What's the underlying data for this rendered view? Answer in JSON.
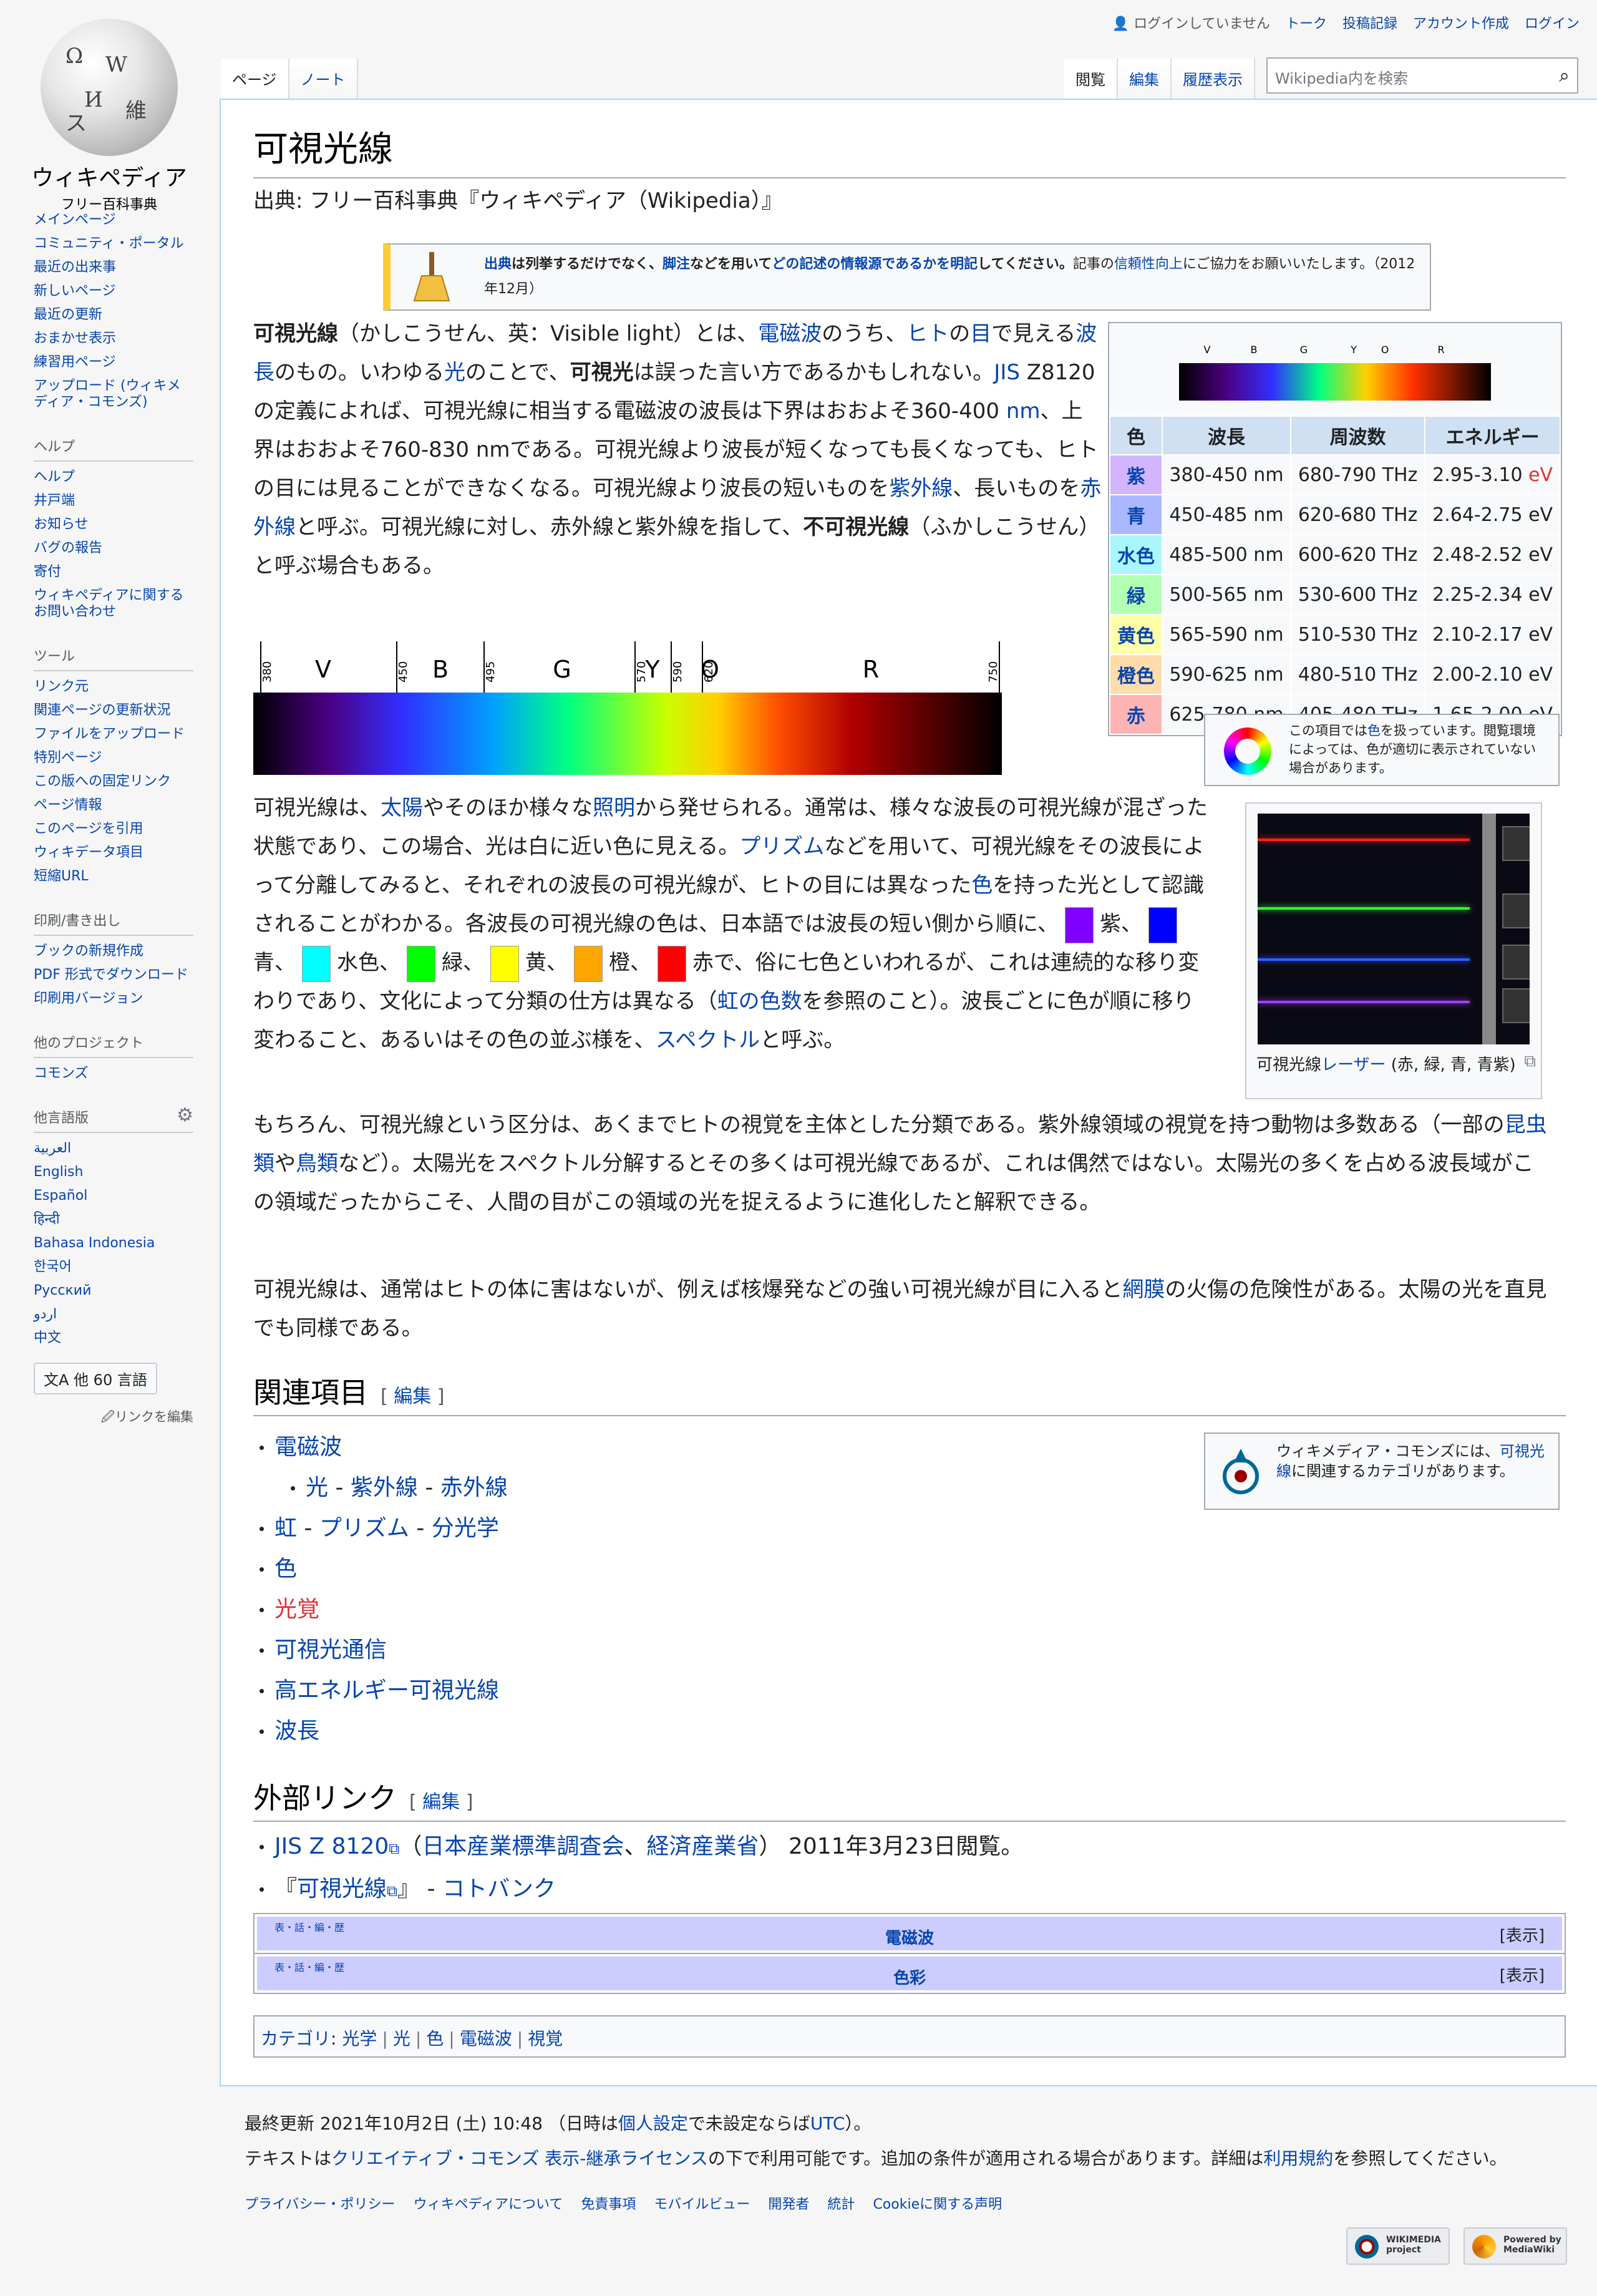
{
  "logo": {
    "wordmark": "ウィキペディア",
    "tagline": "フリー百科事典"
  },
  "personal": {
    "status": "ログインしていません",
    "talk": "トーク",
    "contribs": "投稿記録",
    "create": "アカウント作成",
    "login": "ログイン"
  },
  "tabs": {
    "page": "ページ",
    "note": "ノート",
    "read": "閲覧",
    "edit": "編集",
    "history": "履歴表示"
  },
  "search": {
    "placeholder": "Wikipedia内を検索"
  },
  "sidebar": {
    "nav": [
      "メインページ",
      "コミュニティ・ポータル",
      "最近の出来事",
      "新しいページ",
      "最近の更新",
      "おまかせ表示",
      "練習用ページ",
      "アップロード (ウィキメディア・コモンズ)"
    ],
    "help_heading": "ヘルプ",
    "help": [
      "ヘルプ",
      "井戸端",
      "お知らせ",
      "バグの報告",
      "寄付",
      "ウィキペディアに関するお問い合わせ"
    ],
    "tools_heading": "ツール",
    "tools": [
      "リンク元",
      "関連ページの更新状況",
      "ファイルをアップロード",
      "特別ページ",
      "この版への固定リンク",
      "ページ情報",
      "このページを引用",
      "ウィキデータ項目",
      "短縮URL"
    ],
    "print_heading": "印刷/書き出し",
    "print": [
      "ブックの新規作成",
      "PDF 形式でダウンロード",
      "印刷用バージョン"
    ],
    "projects_heading": "他のプロジェクト",
    "projects": [
      "コモンズ"
    ],
    "lang_heading": "他言語版",
    "langs": [
      "العربية",
      "English",
      "Español",
      "हिन्दी",
      "Bahasa Indonesia",
      "한국어",
      "Русский",
      "اردو",
      "中文"
    ],
    "lang_button": "文A 他 60 言語",
    "edit_links": "🖉リンクを編集"
  },
  "article": {
    "title": "可視光線",
    "site_sub": "出典: フリー百科事典『ウィキペディア（Wikipedia）』",
    "ambox": {
      "a1": "出典",
      "t1": "は列挙するだけでなく、",
      "a2": "脚注",
      "t2": "などを用いて",
      "a3": "どの記述の情報源であるかを明記",
      "t3": "してください。",
      "t4": "記事の",
      "a4": "信頼性向上",
      "t5": "にご協力をお願いいたします。（2012年12月）"
    },
    "p1": {
      "b1": "可視光線",
      "t1": "（かしこうせん、英：Visible light）とは、",
      "l1": "電磁波",
      "t2": "のうち、",
      "l2": "ヒト",
      "t3": "の",
      "l3": "目",
      "t4": "で見える",
      "l4": "波長",
      "t5": "のもの。いわゆる",
      "l5": "光",
      "t6": "のことで、",
      "b2": "可視光",
      "t7": "は誤った言い方であるかもしれない。",
      "l6": "JIS",
      "t8": " Z8120の定義によれば、可視光線に相当する電磁波の波長は下界はおおよそ360-400 ",
      "l7": "nm",
      "t9": "、上界はおおよそ760-830 nmである。可視光線より波長が短くなっても長くなっても、ヒトの目には見ることができなくなる。可視光線より波長の短いものを",
      "l8": "紫外線",
      "t10": "、長いものを",
      "l9": "赤外線",
      "t11": "と呼ぶ。可視光線に対し、赤外線と紫外線を指して、",
      "b3": "不可視光線",
      "t12": "（ふかしこうせん）と呼ぶ場合もある。"
    },
    "p2": {
      "t1": "可視光線は、",
      "l1": "太陽",
      "t2": "やそのほか様々な",
      "l2": "照明",
      "t3": "から発せられる。通常は、様々な波長の可視光線が混ざった状態であり、この場合、光は白に近い色に見える。",
      "l3": "プリズム",
      "t4": "などを用いて、可視光線をその波長によって分離してみると、それぞれの波長の可視光線が、ヒトの目には異なった",
      "l4": "色",
      "t5": "を持った光として認識されることがわかる。各波長の可視光線の色は、日本語では波長の短い側から順に、",
      "c1": "紫、",
      "c2": "青、",
      "c3": "水色、",
      "c4": "緑、",
      "c5": "黄、",
      "c6": "橙、",
      "c7": "赤",
      "t6": "で、俗に七色といわれるが、これは連続的な移り変わりであり、文化によって分類の仕方は異なる（",
      "l5": "虹の色数",
      "t7": "を参照のこと）。波長ごとに色が順に移り変わること、あるいはその色の並ぶ様を、",
      "l6": "スペクトル",
      "t8": "と呼ぶ。"
    },
    "p3": {
      "t1": "もちろん、可視光線という区分は、あくまでヒトの視覚を主体とした分類である。紫外線領域の視覚を持つ動物は多数ある（一部の",
      "l1": "昆虫類",
      "t2": "や",
      "l2": "鳥類",
      "t3": "など）。太陽光をスペクトル分解するとその多くは可視光線であるが、これは偶然ではない。太陽光の多くを占める波長域がこの領域だったからこそ、人間の目がこの領域の光を捉えるように進化したと解釈できる。"
    },
    "p4": {
      "t1": "可視光線は、通常はヒトの体に害はないが、例えば核爆発などの強い可視光線が目に入ると",
      "l1": "網膜",
      "t2": "の火傷の危険性がある。太陽の光を直見でも同様である。"
    },
    "spectrum": {
      "bands": [
        {
          "label": "V",
          "wl": "380"
        },
        {
          "label": "B",
          "wl": "450"
        },
        {
          "label": "G",
          "wl": "495"
        },
        {
          "label": "Y",
          "wl": "570"
        },
        {
          "label": "O",
          "wl": "590"
        },
        {
          "label": "R",
          "wl": "620"
        }
      ],
      "end": "750"
    },
    "infobox": {
      "spec_letters": [
        "V",
        "B",
        "G",
        "Y",
        "O",
        "R"
      ],
      "headers": [
        "色",
        "波長",
        "周波数",
        "エネルギー"
      ],
      "rows": [
        {
          "name": "紫",
          "bg": "#d2b4ff",
          "wl": "380-450 nm",
          "freq": "680-790 THz",
          "energy": "2.95-3.10 ",
          "unit": "eV"
        },
        {
          "name": "青",
          "bg": "#aab7ff",
          "wl": "450-485 nm",
          "freq": "620-680 THz",
          "energy": "2.64-2.75 eV",
          "unit": ""
        },
        {
          "name": "水色",
          "bg": "#aaf6ff",
          "wl": "485-500 nm",
          "freq": "600-620 THz",
          "energy": "2.48-2.52 eV",
          "unit": ""
        },
        {
          "name": "緑",
          "bg": "#b3ffb3",
          "wl": "500-565 nm",
          "freq": "530-600 THz",
          "energy": "2.25-2.34 eV",
          "unit": ""
        },
        {
          "name": "黄色",
          "bg": "#ffffaa",
          "wl": "565-590 nm",
          "freq": "510-530 THz",
          "energy": "2.10-2.17 eV",
          "unit": ""
        },
        {
          "name": "橙色",
          "bg": "#ffdcaa",
          "wl": "590-625 nm",
          "freq": "480-510 THz",
          "energy": "2.00-2.10 eV",
          "unit": ""
        },
        {
          "name": "赤",
          "bg": "#ffb4b4",
          "wl": "625-780 nm",
          "freq": "405-480 THz",
          "energy": "1.65-2.00 eV",
          "unit": ""
        }
      ]
    },
    "color_note": {
      "t1": "この項目では",
      "l1": "色",
      "t2": "を扱っています。閲覧環境によっては、色が適切に表示されていない場合があります。"
    },
    "thumb": {
      "t1": "可視光線",
      "l1": "レーザー",
      "t2": " (赤, 緑, 青, 青紫)"
    },
    "related": {
      "heading": "関連項目",
      "edit": "編集",
      "items": [
        "電磁波",
        "光",
        "紫外線",
        "赤外線",
        "虹",
        "プリズム",
        "分光学",
        "色",
        "光覚",
        "可視光通信",
        "高エネルギー可視光線",
        "波長"
      ]
    },
    "commons": {
      "t1": "ウィキメディア・コモンズには、",
      "l1": "可視光線",
      "t2": "に関連するカテゴリがあります。"
    },
    "external": {
      "heading": "外部リンク",
      "edit": "編集",
      "e1_link": "JIS Z 8120",
      "e1_a": "（",
      "e1_l2": "日本産業標準調査会",
      "e1_b": "、",
      "e1_l3": "経済産業省",
      "e1_c": "） 2011年3月23日閲覧。",
      "e2_a": "『",
      "e2_link": "可視光線",
      "e2_b": "』 - ",
      "e2_l2": "コトバンク"
    },
    "navboxes": [
      {
        "vte": "表・話・編・歴",
        "title": "電磁波",
        "show": "[表示]"
      },
      {
        "vte": "表・話・編・歴",
        "title": "色彩",
        "show": "[表示]"
      }
    ],
    "categories": {
      "label": "カテゴリ",
      "items": [
        "光学",
        "光",
        "色",
        "電磁波",
        "視覚"
      ]
    }
  },
  "footer": {
    "lastmod_a": "最終更新 2021年10月2日 (土) 10:48 （日時は",
    "lastmod_l1": "個人設定",
    "lastmod_b": "で未設定ならば",
    "lastmod_l2": "UTC",
    "lastmod_c": "）。",
    "license_a": "テキストは",
    "license_l1": "クリエイティブ・コモンズ 表示-継承ライセンス",
    "license_b": "の下で利用可能です。追加の条件が適用される場合があります。詳細は",
    "license_l2": "利用規約",
    "license_c": "を参照してください。",
    "places": [
      "プライバシー・ポリシー",
      "ウィキペディアについて",
      "免責事項",
      "モバイルビュー",
      "開発者",
      "統計",
      "Cookieに関する声明"
    ],
    "badge1": "WIKIMEDIA project",
    "badge2": "Powered by MediaWiki"
  }
}
